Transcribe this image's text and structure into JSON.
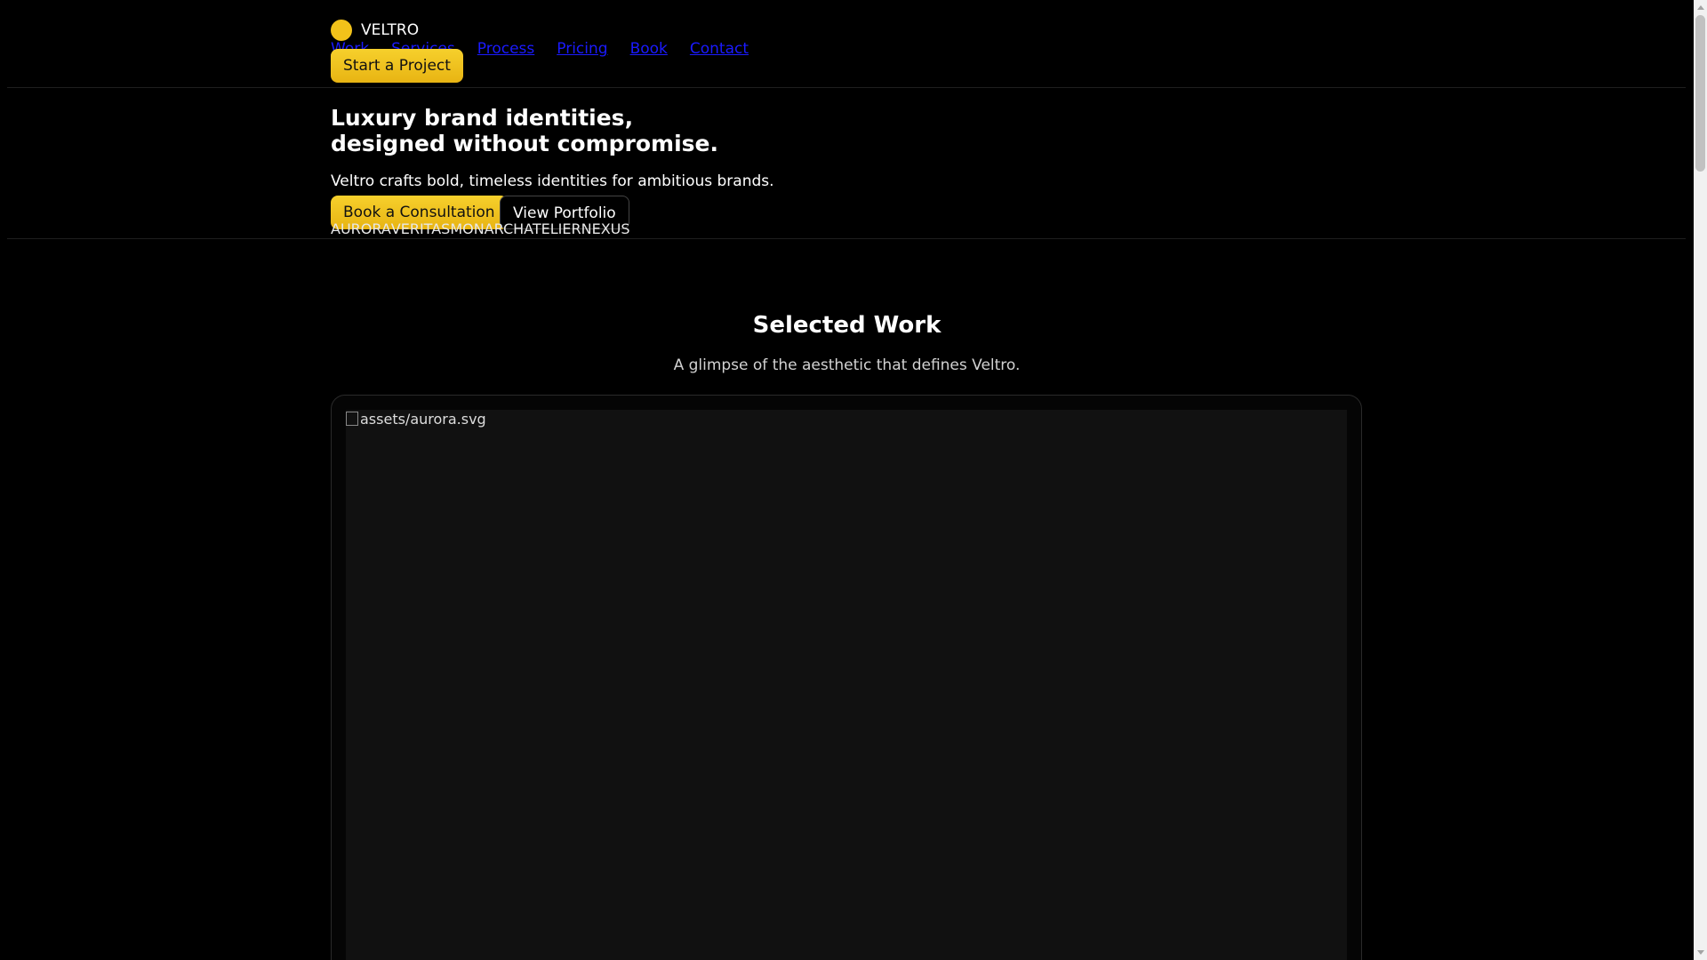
{
  "brand": {
    "name": "VELTRO",
    "accent_color": "#f2c21a",
    "logo_icon": "circle-logo-icon"
  },
  "nav": {
    "items": [
      {
        "label": "Work"
      },
      {
        "label": "Services"
      },
      {
        "label": "Process"
      },
      {
        "label": "Pricing"
      },
      {
        "label": "Book"
      },
      {
        "label": "Contact"
      }
    ],
    "cta_label": "Start a Project"
  },
  "hero": {
    "title_line1": "Luxury brand identities,",
    "title_line2": "designed without compromise.",
    "subtitle": "Veltro crafts bold, timeless identities for ambitious brands.",
    "primary_label": "Book a Consultation",
    "secondary_label": "View Portfolio"
  },
  "clients": [
    "AURORA",
    "VERITAS",
    "MONARCH",
    "ATELIER",
    "NEXUS"
  ],
  "work": {
    "title": "Selected Work",
    "subtitle": "A glimpse of the aesthetic that defines Veltro.",
    "image_alt": "assets/aurora.svg"
  }
}
